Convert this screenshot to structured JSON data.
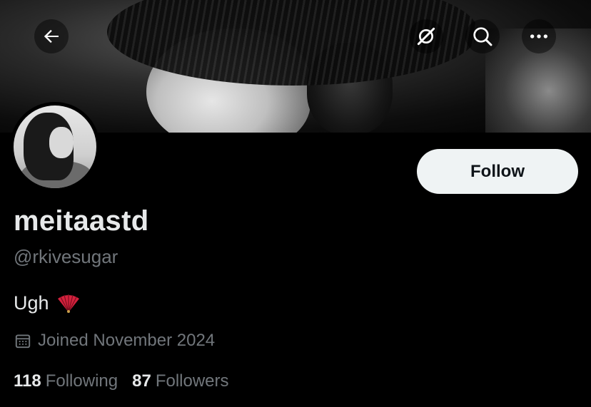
{
  "profile": {
    "display_name": "meitaastd",
    "handle": "@rkivesugar",
    "bio_text": "Ugh",
    "bio_emoji": "folding-fan-emoji",
    "joined": "Joined November 2024",
    "following_count": "118",
    "following_label": "Following",
    "followers_count": "87",
    "followers_label": "Followers"
  },
  "actions": {
    "follow_label": "Follow"
  },
  "icons": {
    "back": "arrow-left-icon",
    "grok": "grok-icon",
    "search": "search-icon",
    "more": "more-horizontal-icon",
    "calendar": "calendar-icon"
  },
  "colors": {
    "background": "#000000",
    "primary_text": "#e7e9ea",
    "secondary_text": "#71767b",
    "follow_button_bg": "#eff3f4",
    "follow_button_text": "#0f1419"
  }
}
